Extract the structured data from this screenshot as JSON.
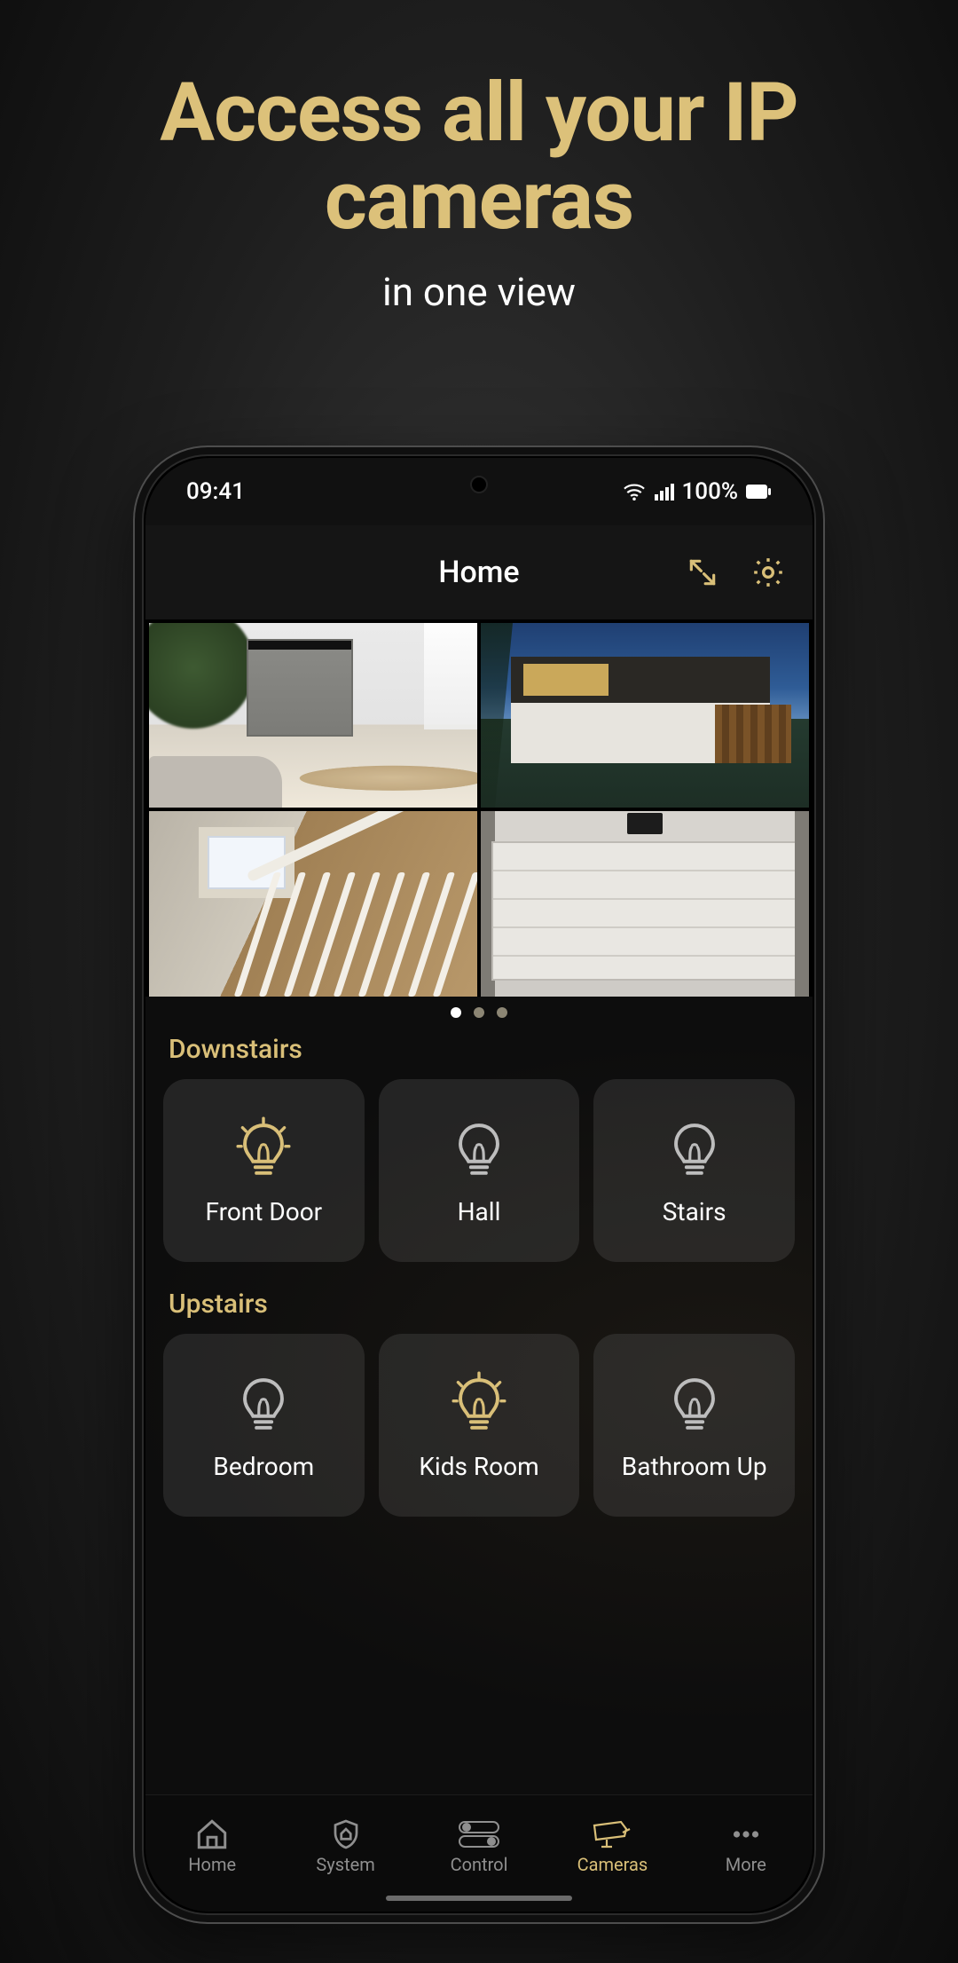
{
  "hero": {
    "headline": "Access all your IP cameras",
    "subhead": "in one view"
  },
  "statusbar": {
    "time": "09:41",
    "battery_text": "100%"
  },
  "header": {
    "title": "Home"
  },
  "cameras": {
    "tiles": [
      {
        "name": "living-room"
      },
      {
        "name": "front-exterior"
      },
      {
        "name": "stairs-cam"
      },
      {
        "name": "garage"
      }
    ],
    "page_count": 3,
    "active_page": 0
  },
  "sections": [
    {
      "label": "Downstairs",
      "items": [
        {
          "label": "Front Door",
          "on": true
        },
        {
          "label": "Hall",
          "on": false
        },
        {
          "label": "Stairs",
          "on": false
        }
      ]
    },
    {
      "label": "Upstairs",
      "items": [
        {
          "label": "Bedroom",
          "on": false
        },
        {
          "label": "Kids Room",
          "on": true
        },
        {
          "label": "Bathroom Up",
          "on": false
        }
      ]
    }
  ],
  "tabs": [
    {
      "label": "Home",
      "icon": "home"
    },
    {
      "label": "System",
      "icon": "shield"
    },
    {
      "label": "Control",
      "icon": "toggle"
    },
    {
      "label": "Cameras",
      "icon": "camera"
    },
    {
      "label": "More",
      "icon": "more"
    }
  ],
  "active_tab": 3,
  "colors": {
    "accent": "#d9bf78"
  }
}
